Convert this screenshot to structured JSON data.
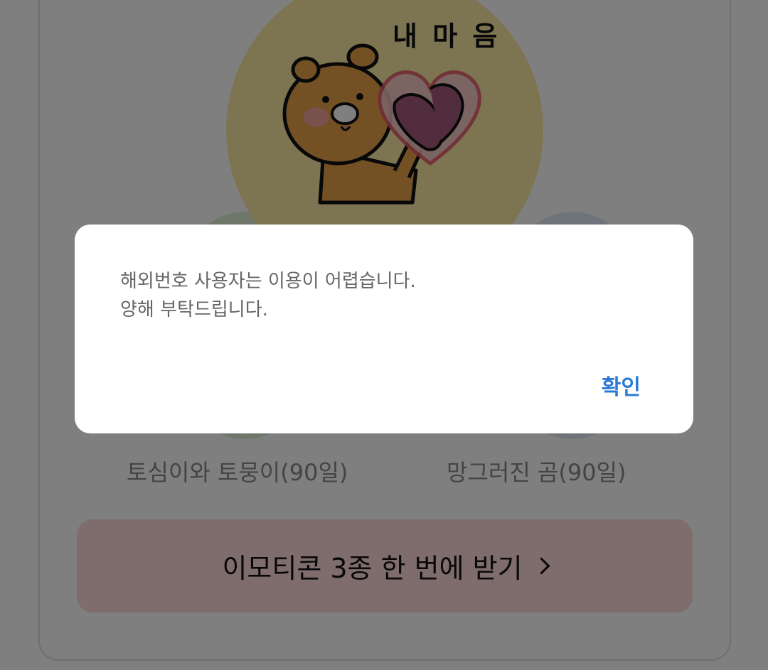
{
  "background": {
    "emoticon_sticker_text": "내 마 음",
    "emoticons": [
      {
        "label": "토심이와 토뭉이(90일)"
      },
      {
        "label": "망그러진 곰(90일)"
      }
    ],
    "cta_label": "이모티콘 3종 한 번에 받기",
    "cta_icon": "chevron-right-icon",
    "cta_color": "#ffd8d8",
    "main_emoticon_bg": "#fbeaa3"
  },
  "dialog": {
    "message_line1": "해외번호 사용자는 이용이 어렵습니다.",
    "message_line2": "양해 부탁드립니다.",
    "confirm_label": "확인",
    "confirm_color": "#2b7bd6"
  }
}
